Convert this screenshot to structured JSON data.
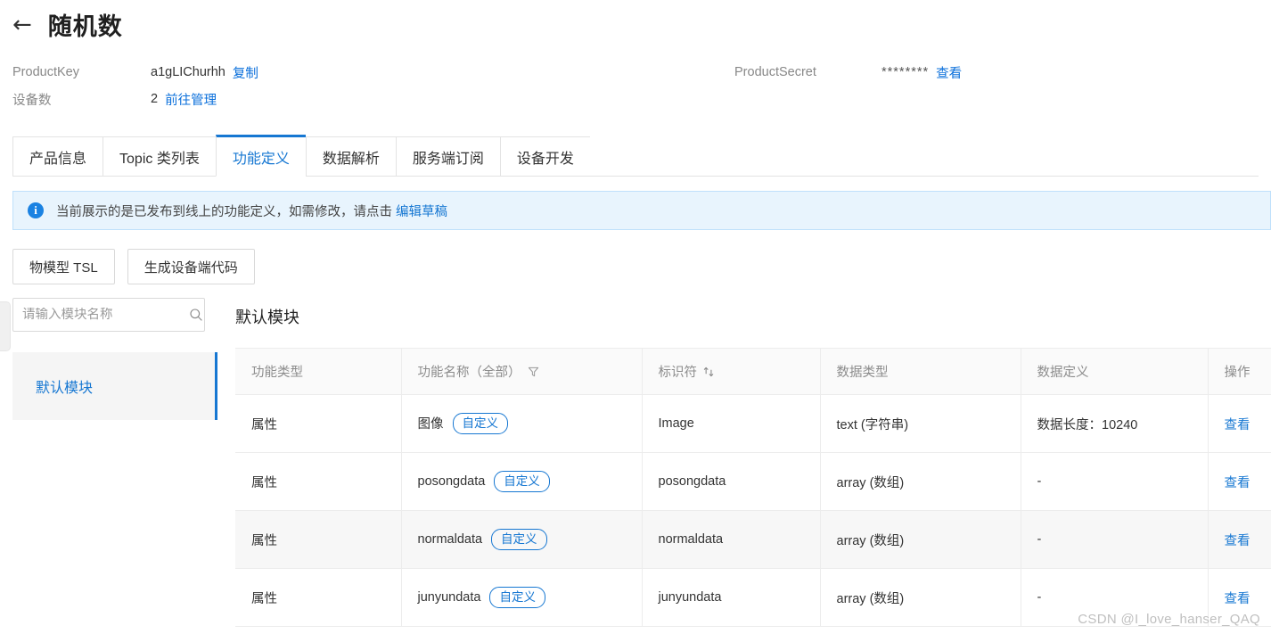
{
  "header": {
    "back_icon": "arrow-left-icon",
    "title": "随机数",
    "product_key_label": "ProductKey",
    "product_key_value": "a1gLIChurhh",
    "copy_label": "复制",
    "device_count_label": "设备数",
    "device_count_value": "2",
    "manage_link": "前往管理",
    "product_secret_label": "ProductSecret",
    "product_secret_value": "********",
    "view_label": "查看"
  },
  "tabs": [
    {
      "label": "产品信息",
      "active": false
    },
    {
      "label": "Topic 类列表",
      "active": false
    },
    {
      "label": "功能定义",
      "active": true
    },
    {
      "label": "数据解析",
      "active": false
    },
    {
      "label": "服务端订阅",
      "active": false
    },
    {
      "label": "设备开发",
      "active": false
    }
  ],
  "banner": {
    "icon": "info-circle-icon",
    "text": "当前展示的是已发布到线上的功能定义，如需修改，请点击 ",
    "link": "编辑草稿"
  },
  "actions": [
    {
      "label": "物模型 TSL"
    },
    {
      "label": "生成设备端代码"
    }
  ],
  "sidebar": {
    "search_placeholder": "请输入模块名称",
    "search_value": "",
    "search_icon": "search-icon",
    "modules": [
      {
        "label": "默认模块",
        "selected": true
      }
    ]
  },
  "panel": {
    "title": "默认模块",
    "columns": [
      {
        "label": "功能类型",
        "icon": null
      },
      {
        "label": "功能名称（全部）",
        "icon": "filter-icon"
      },
      {
        "label": "标识符",
        "icon": "sort-icon"
      },
      {
        "label": "数据类型",
        "icon": null
      },
      {
        "label": "数据定义",
        "icon": null
      },
      {
        "label": "操作",
        "icon": null
      }
    ],
    "rows": [
      {
        "type": "属性",
        "name": "图像",
        "badge": "自定义",
        "identifier": "Image",
        "data_type": "text (字符串)",
        "data_definition": "数据长度：10240",
        "action": "查看",
        "hovered": false
      },
      {
        "type": "属性",
        "name": "posongdata",
        "badge": "自定义",
        "identifier": "posongdata",
        "data_type": "array (数组)",
        "data_definition": "-",
        "action": "查看",
        "hovered": false
      },
      {
        "type": "属性",
        "name": "normaldata",
        "badge": "自定义",
        "identifier": "normaldata",
        "data_type": "array (数组)",
        "data_definition": "-",
        "action": "查看",
        "hovered": true
      },
      {
        "type": "属性",
        "name": "junyundata",
        "badge": "自定义",
        "identifier": "junyundata",
        "data_type": "array (数组)",
        "data_definition": "-",
        "action": "查看",
        "hovered": false
      }
    ]
  },
  "watermark": "CSDN @I_love_hanser_QAQ",
  "colors": {
    "accent": "#1677d2",
    "link": "#0a6fdb",
    "banner_bg": "#e8f4fd",
    "banner_border": "#bfe0fb"
  }
}
